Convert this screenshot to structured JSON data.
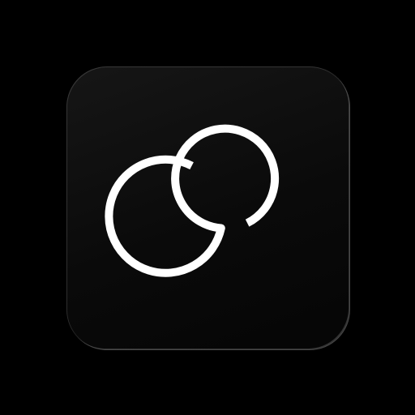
{
  "app_icon": {
    "icon": "infinity-icon",
    "background_color": "#0b0b0b",
    "glyph_color": "#ffffff"
  }
}
